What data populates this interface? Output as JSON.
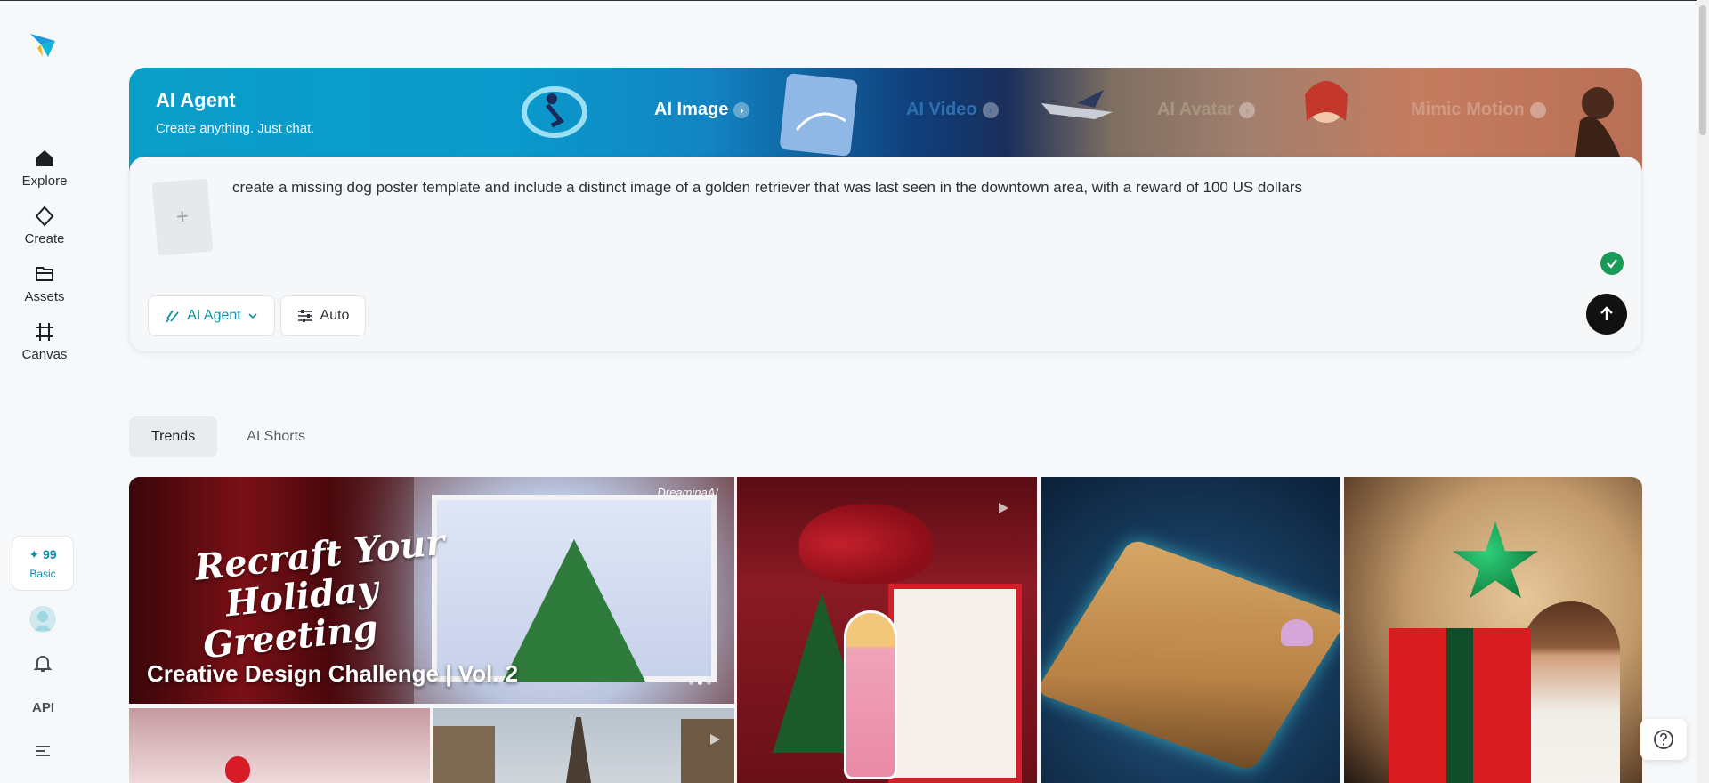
{
  "sidebar": {
    "items": [
      {
        "label": "Explore",
        "icon": "home-icon"
      },
      {
        "label": "Create",
        "icon": "diamond-icon"
      },
      {
        "label": "Assets",
        "icon": "folder-icon"
      },
      {
        "label": "Canvas",
        "icon": "crop-frame-icon"
      }
    ],
    "credits": {
      "count": "99",
      "tier": "Basic"
    },
    "api_label": "API"
  },
  "banner": {
    "title": "AI Agent",
    "subtitle": "Create anything. Just chat.",
    "tiles": [
      {
        "label": "AI Image",
        "color": "#ffffff"
      },
      {
        "label": "AI Video",
        "color": "#2c6fb1"
      },
      {
        "label": "AI Avatar",
        "color": "#a7967f"
      },
      {
        "label": "Mimic Motion",
        "color": "#cf9a83"
      }
    ]
  },
  "prompt": {
    "text": "create a missing dog poster template and include a distinct image of a golden retriever that was last seen in the downtown area, with a reward of 100 US dollars",
    "mode_label": "AI Agent",
    "auto_label": "Auto"
  },
  "tabs": [
    {
      "label": "Trends",
      "active": true
    },
    {
      "label": "AI Shorts",
      "active": false
    }
  ],
  "gallery": {
    "featured": {
      "script_line1": "Recraft Your",
      "script_line2": "Holiday",
      "script_line3": "Greeting",
      "brand": "DreaminaAI",
      "caption": "Creative Design Challenge | Vol. 2"
    }
  },
  "colors": {
    "accent": "#0a8fa8",
    "success": "#1a9a57",
    "send": "#111111"
  }
}
